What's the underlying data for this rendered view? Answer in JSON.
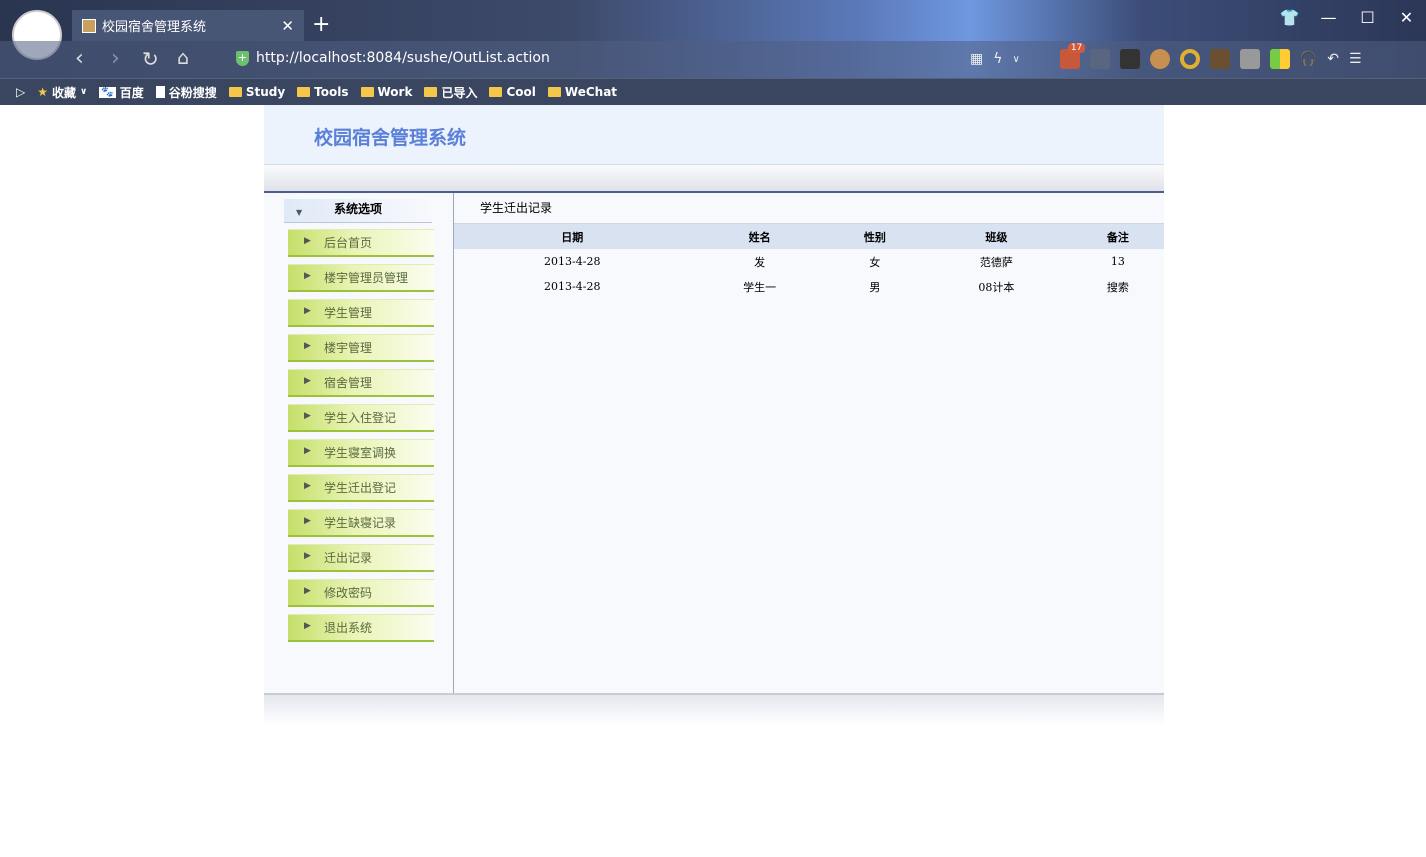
{
  "browser": {
    "tab_title": "校园宿舍管理系统",
    "url": "http://localhost:8084/sushe/OutList.action",
    "ext_badge": "17",
    "bookmarks": [
      {
        "label": "收藏",
        "icon": "star-icon"
      },
      {
        "label": "百度",
        "icon": "baidu-icon"
      },
      {
        "label": "谷粉搜搜",
        "icon": "page-icon"
      },
      {
        "label": "Study",
        "icon": "folder-icon"
      },
      {
        "label": "Tools",
        "icon": "folder-icon"
      },
      {
        "label": "Work",
        "icon": "folder-icon"
      },
      {
        "label": "已导入",
        "icon": "folder-icon"
      },
      {
        "label": "Cool",
        "icon": "folder-icon"
      },
      {
        "label": "WeChat",
        "icon": "folder-icon"
      }
    ]
  },
  "app": {
    "title": "校园宿舍管理系统"
  },
  "sidebar": {
    "heading": "系统选项",
    "items": [
      "后台首页",
      "楼宇管理员管理",
      "学生管理",
      "楼宇管理",
      "宿舍管理",
      "学生入住登记",
      "学生寝室调换",
      "学生迁出登记",
      "学生缺寝记录",
      "迁出记录",
      "修改密码",
      "退出系统"
    ]
  },
  "main": {
    "title": "学生迁出记录",
    "columns": [
      "日期",
      "姓名",
      "性别",
      "班级",
      "备注"
    ],
    "rows": [
      [
        "2013-4-28",
        "发",
        "女",
        "范德萨",
        "13"
      ],
      [
        "2013-4-28",
        "学生一",
        "男",
        "08计本",
        "搜索"
      ]
    ]
  }
}
